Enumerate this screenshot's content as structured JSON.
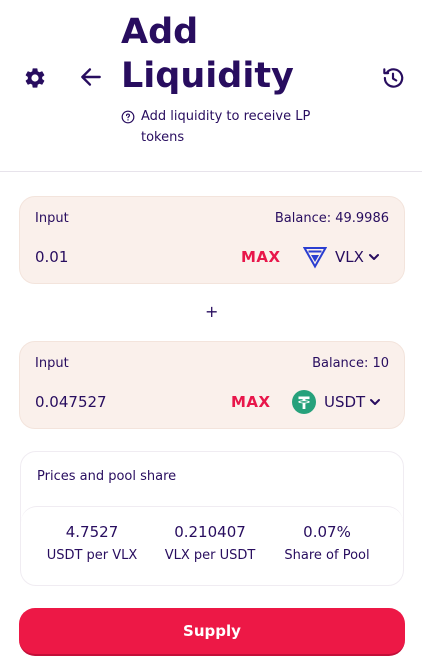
{
  "header": {
    "title": "Add Liquidity",
    "subtitle": "Add liquidity to receive LP tokens",
    "icons": {
      "settings": "gear-icon",
      "back": "arrow-left-icon",
      "history": "history-icon",
      "help": "question-circle-icon"
    }
  },
  "inputs": [
    {
      "label": "Input",
      "balance": "Balance: 49.9986",
      "value": "0.01",
      "max_label": "MAX",
      "token": "VLX",
      "token_icon": "velas-logo-icon"
    },
    {
      "label": "Input",
      "balance": "Balance: 10",
      "value": "0.047527",
      "max_label": "MAX",
      "token": "USDT",
      "token_icon": "tether-logo-icon"
    }
  ],
  "plus": "+",
  "prices": {
    "title": "Prices and pool share",
    "stats": [
      {
        "value": "4.7527",
        "label": "USDT per VLX"
      },
      {
        "value": "0.210407",
        "label": "VLX per USDT"
      },
      {
        "value": "0.07%",
        "label": "Share of Pool"
      }
    ]
  },
  "supply_label": "Supply",
  "colors": {
    "text": "#280d5f",
    "accent": "#e8164a",
    "panel": "#faf0eb",
    "button": "#ed1846",
    "tether": "#26a17b",
    "velas": "#2a3ed1"
  }
}
